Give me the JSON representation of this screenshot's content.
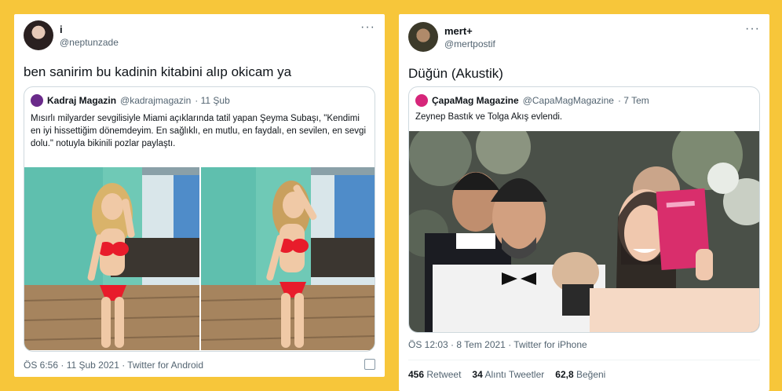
{
  "tweet1": {
    "name": "i",
    "handle": "@neptunzade",
    "text": "ben sanirim bu kadinin kitabini alıp okicam ya",
    "quote": {
      "account": "Kadraj Magazin",
      "handle": "@kadrajmagazin",
      "date": "· 11 Şub",
      "text": "Mısırlı milyarder sevgilisiyle Miami açıklarında tatil yapan Şeyma Subaşı, \"Kendimi en iyi hissettiğim dönemdeyim. En sağlıklı, en mutlu, en faydalı, en sevilen, en sevgi dolu.\" notuyla bikinili pozlar paylaştı.",
      "logo_color": "#6a2a8a"
    },
    "meta": "ÖS 6:56 · 11 Şub 2021 · Twitter for Android"
  },
  "tweet2": {
    "name": "mert+",
    "handle": "@mertpostif",
    "text": "Düğün (Akustik)",
    "quote": {
      "account": "ÇapaMag Magazine",
      "handle": "@CapaMagMagazine",
      "date": "· 7 Tem",
      "text": "Zeynep Bastık ve Tolga Akış evlendi.",
      "logo_color": "#d6267a"
    },
    "meta": "ÖS 12:03 · 8 Tem 2021 · Twitter for iPhone",
    "stats": [
      {
        "value": "456",
        "label": "Retweet"
      },
      {
        "value": "34",
        "label": "Alıntı Tweetler"
      },
      {
        "value": "62,8",
        "label": "Beğeni"
      }
    ]
  },
  "icons": {
    "more": "more-horizontal-icon",
    "data": "analytics-icon"
  }
}
